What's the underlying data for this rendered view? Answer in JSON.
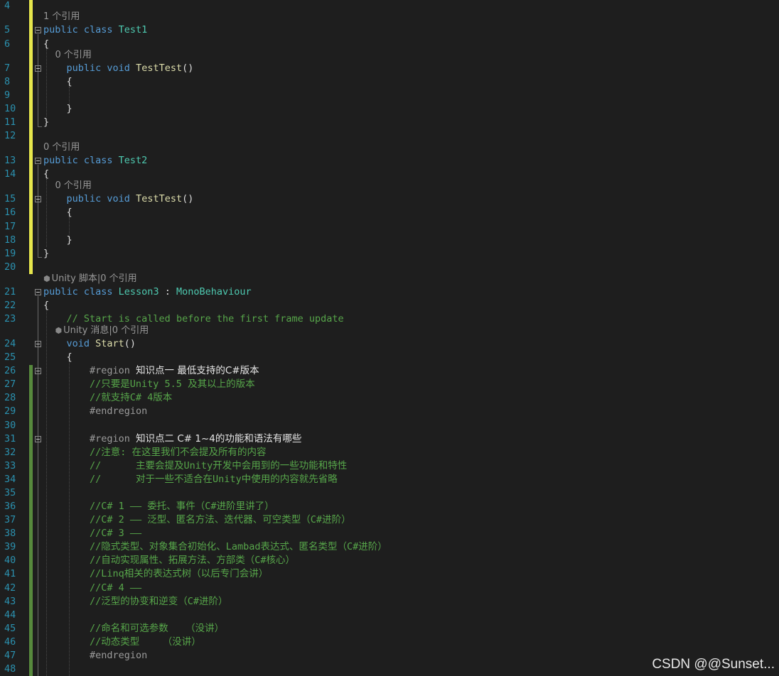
{
  "watermark": "CSDN @@Sunset...",
  "colors": {
    "background": "#1e1e1e",
    "line_number": "#2b91af",
    "keyword": "#569cd6",
    "type": "#4ec9b0",
    "method": "#dcdcaa",
    "comment": "#57a64a",
    "codelens": "#999999",
    "changed_unsaved": "#e6e64c",
    "changed_saved": "#578a3d"
  },
  "lines": [
    {
      "n": "4",
      "tokens": []
    },
    {
      "n": "5",
      "lens": "1 个引用",
      "tokens": [
        {
          "t": "kw",
          "v": "public class "
        },
        {
          "t": "type",
          "v": "Test1"
        }
      ],
      "fold": true
    },
    {
      "n": "6",
      "tokens": [
        {
          "t": "plain",
          "v": "{"
        }
      ]
    },
    {
      "n": "7",
      "lens": "    0 个引用",
      "tokens": [
        {
          "t": "plain",
          "v": "    "
        },
        {
          "t": "kw",
          "v": "public void "
        },
        {
          "t": "method",
          "v": "TestTest"
        },
        {
          "t": "plain",
          "v": "()"
        }
      ],
      "fold": true
    },
    {
      "n": "8",
      "tokens": [
        {
          "t": "plain",
          "v": "    {"
        }
      ]
    },
    {
      "n": "9",
      "tokens": []
    },
    {
      "n": "10",
      "tokens": [
        {
          "t": "plain",
          "v": "    }"
        }
      ]
    },
    {
      "n": "11",
      "tokens": [
        {
          "t": "plain",
          "v": "}"
        }
      ]
    },
    {
      "n": "12",
      "tokens": []
    },
    {
      "n": "13",
      "lens": "0 个引用",
      "tokens": [
        {
          "t": "kw",
          "v": "public class "
        },
        {
          "t": "type",
          "v": "Test2"
        }
      ],
      "fold": true
    },
    {
      "n": "14",
      "tokens": [
        {
          "t": "plain",
          "v": "{"
        }
      ]
    },
    {
      "n": "15",
      "lens": "    0 个引用",
      "tokens": [
        {
          "t": "plain",
          "v": "    "
        },
        {
          "t": "kw",
          "v": "public void "
        },
        {
          "t": "method",
          "v": "TestTest"
        },
        {
          "t": "plain",
          "v": "()"
        }
      ],
      "fold": true
    },
    {
      "n": "16",
      "tokens": [
        {
          "t": "plain",
          "v": "    {"
        }
      ]
    },
    {
      "n": "17",
      "tokens": []
    },
    {
      "n": "18",
      "tokens": [
        {
          "t": "plain",
          "v": "    }"
        }
      ]
    },
    {
      "n": "19",
      "tokens": [
        {
          "t": "plain",
          "v": "}"
        }
      ]
    },
    {
      "n": "20",
      "tokens": []
    },
    {
      "n": "21",
      "lens": "Unity 脚本|0 个引用",
      "lens_icon": true,
      "tokens": [
        {
          "t": "kw",
          "v": "public class "
        },
        {
          "t": "type",
          "v": "Lesson3"
        },
        {
          "t": "plain",
          "v": " : "
        },
        {
          "t": "type",
          "v": "MonoBehaviour"
        }
      ],
      "fold": true
    },
    {
      "n": "22",
      "tokens": [
        {
          "t": "plain",
          "v": "{"
        }
      ]
    },
    {
      "n": "23",
      "tokens": [
        {
          "t": "plain",
          "v": "    "
        },
        {
          "t": "comment",
          "v": "// Start is called before the first frame update"
        }
      ]
    },
    {
      "n": "24",
      "lens": "    Unity 消息|0 个引用",
      "lens_icon": true,
      "tokens": [
        {
          "t": "plain",
          "v": "    "
        },
        {
          "t": "kw",
          "v": "void "
        },
        {
          "t": "method",
          "v": "Start"
        },
        {
          "t": "plain",
          "v": "()"
        }
      ],
      "fold": true
    },
    {
      "n": "25",
      "tokens": [
        {
          "t": "plain",
          "v": "    {"
        }
      ]
    },
    {
      "n": "26",
      "tokens": [
        {
          "t": "plain",
          "v": "        "
        },
        {
          "t": "region",
          "v": "#region "
        },
        {
          "t": "regionname",
          "v": "知识点一 最低支持的C#版本"
        }
      ],
      "fold": true
    },
    {
      "n": "27",
      "tokens": [
        {
          "t": "plain",
          "v": "        "
        },
        {
          "t": "comment",
          "v": "//只要是Unity 5.5 及其以上的版本"
        }
      ]
    },
    {
      "n": "28",
      "tokens": [
        {
          "t": "plain",
          "v": "        "
        },
        {
          "t": "comment",
          "v": "//就支持C# 4版本"
        }
      ]
    },
    {
      "n": "29",
      "tokens": [
        {
          "t": "plain",
          "v": "        "
        },
        {
          "t": "region",
          "v": "#endregion"
        }
      ]
    },
    {
      "n": "30",
      "tokens": []
    },
    {
      "n": "31",
      "tokens": [
        {
          "t": "plain",
          "v": "        "
        },
        {
          "t": "region",
          "v": "#region "
        },
        {
          "t": "regionname",
          "v": "知识点二 C# 1~4的功能和语法有哪些"
        }
      ],
      "fold": true
    },
    {
      "n": "32",
      "tokens": [
        {
          "t": "plain",
          "v": "        "
        },
        {
          "t": "comment",
          "v": "//注意: 在这里我们不会提及所有的内容"
        }
      ]
    },
    {
      "n": "33",
      "tokens": [
        {
          "t": "plain",
          "v": "        "
        },
        {
          "t": "comment",
          "v": "//      主要会提及Unity开发中会用到的一些功能和特性"
        }
      ]
    },
    {
      "n": "34",
      "tokens": [
        {
          "t": "plain",
          "v": "        "
        },
        {
          "t": "comment",
          "v": "//      对于一些不适合在Unity中使用的内容就先省略"
        }
      ]
    },
    {
      "n": "35",
      "tokens": []
    },
    {
      "n": "36",
      "tokens": [
        {
          "t": "plain",
          "v": "        "
        },
        {
          "t": "comment",
          "v": "//C# 1 —— 委托、事件（C#进阶里讲了）"
        }
      ]
    },
    {
      "n": "37",
      "tokens": [
        {
          "t": "plain",
          "v": "        "
        },
        {
          "t": "comment",
          "v": "//C# 2 —— 泛型、匿名方法、迭代器、可空类型（C#进阶）"
        }
      ]
    },
    {
      "n": "38",
      "tokens": [
        {
          "t": "plain",
          "v": "        "
        },
        {
          "t": "comment",
          "v": "//C# 3 ——"
        }
      ]
    },
    {
      "n": "39",
      "tokens": [
        {
          "t": "plain",
          "v": "        "
        },
        {
          "t": "comment",
          "v": "//隐式类型、对象集合初始化、Lambad表达式、匿名类型（C#进阶）"
        }
      ]
    },
    {
      "n": "40",
      "tokens": [
        {
          "t": "plain",
          "v": "        "
        },
        {
          "t": "comment",
          "v": "//自动实现属性、拓展方法、方部类（C#核心）"
        }
      ]
    },
    {
      "n": "41",
      "tokens": [
        {
          "t": "plain",
          "v": "        "
        },
        {
          "t": "comment",
          "v": "//Linq相关的表达式树（以后专门会讲）"
        }
      ]
    },
    {
      "n": "42",
      "tokens": [
        {
          "t": "plain",
          "v": "        "
        },
        {
          "t": "comment",
          "v": "//C# 4 ——"
        }
      ]
    },
    {
      "n": "43",
      "tokens": [
        {
          "t": "plain",
          "v": "        "
        },
        {
          "t": "comment",
          "v": "//泛型的协变和逆变（C#进阶）"
        }
      ]
    },
    {
      "n": "44",
      "tokens": []
    },
    {
      "n": "45",
      "tokens": [
        {
          "t": "plain",
          "v": "        "
        },
        {
          "t": "comment",
          "v": "//命名和可选参数   （没讲）"
        }
      ]
    },
    {
      "n": "46",
      "tokens": [
        {
          "t": "plain",
          "v": "        "
        },
        {
          "t": "comment",
          "v": "//动态类型    （没讲）"
        }
      ]
    },
    {
      "n": "47",
      "tokens": [
        {
          "t": "plain",
          "v": "        "
        },
        {
          "t": "region",
          "v": "#endregion"
        }
      ]
    },
    {
      "n": "48",
      "tokens": []
    }
  ]
}
